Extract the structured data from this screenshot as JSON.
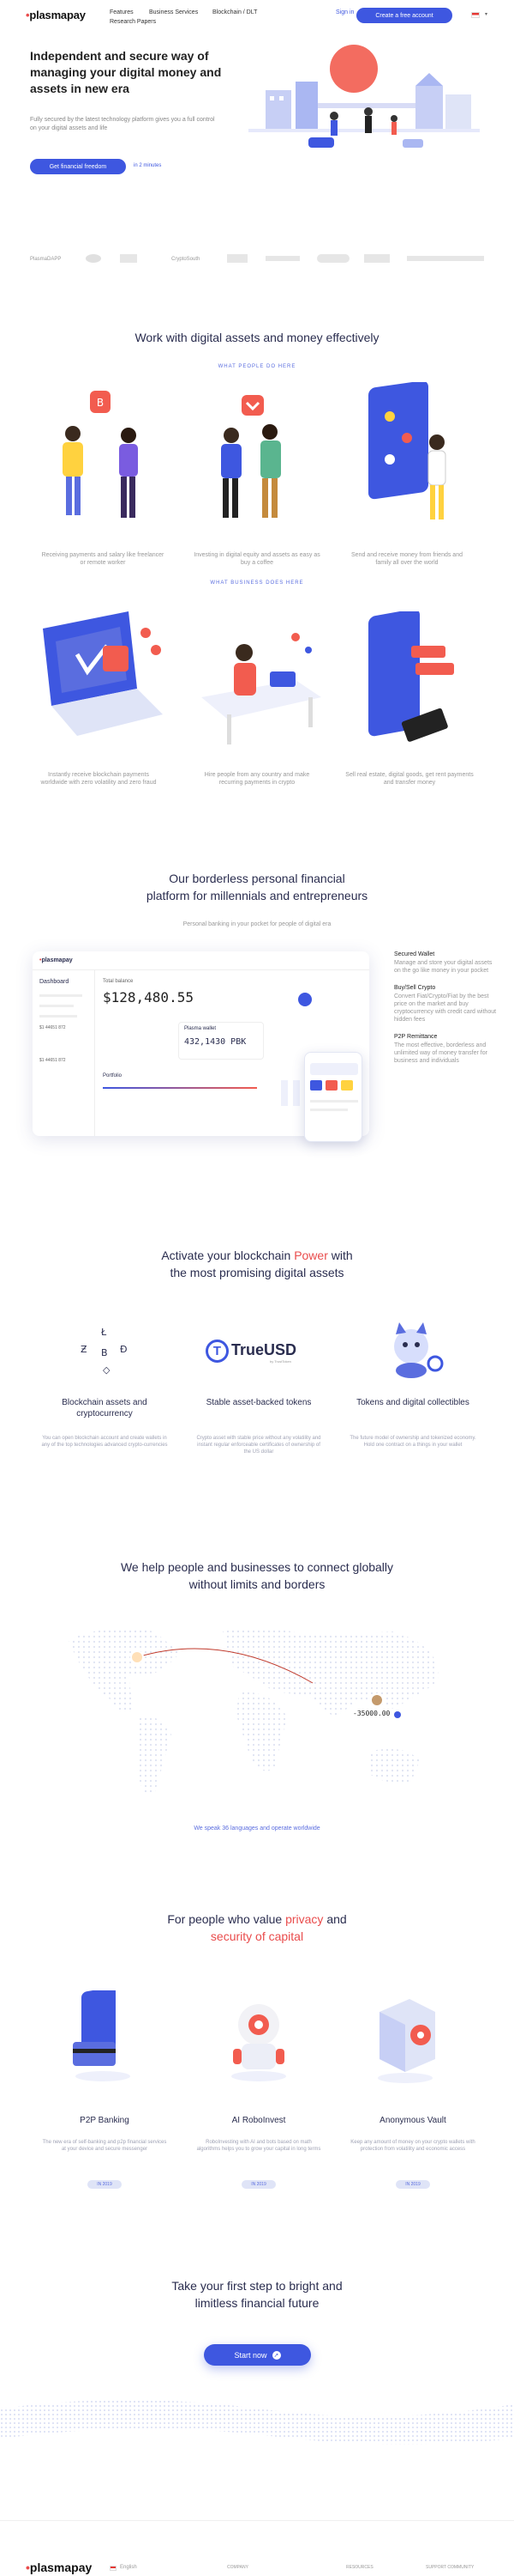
{
  "brand": {
    "name_a": "plasma",
    "name_b": "pay"
  },
  "nav": {
    "features": "Features",
    "business": "Business Services",
    "blockchain": "Blockchain / DLT",
    "research": "Research Papers",
    "signin": "Sign in",
    "cta": "Create a free account"
  },
  "hero": {
    "title": "Independent and secure way of managing your digital money and assets in new era",
    "subtitle": "Fully secured by the latest technology platform gives you a full control on your digital assets and life",
    "button": "Get financial freedom",
    "note": "in 2 minutes"
  },
  "partners": [
    "PlasmaDAPP",
    "",
    "CryptoSouth",
    "",
    ""
  ],
  "effective": {
    "title": "Work with digital assets and money effectively",
    "people_label": "WHAT PEOPLE DO HERE",
    "people": [
      "Receiving payments and salary like freelancer or remote worker",
      "Investing in digital equity and assets as easy as buy a coffee",
      "Send and receive money from friends and family all over the world"
    ],
    "business_label": "WHAT BUSINESS DOES HERE",
    "business": [
      "Instantly receive blockchain payments worldwide with zero volatility and zero fraud",
      "Hire people from any country and make recurring payments in crypto",
      "Sell real estate, digital goods, get rent payments and transfer money"
    ]
  },
  "platform": {
    "title_1": "Our borderless personal financial",
    "title_2": "platform for millennials and entrepreneurs",
    "subtitle": "Personal banking in your pocket for people of digital era",
    "mock": {
      "dashboard": "Dashboard",
      "total": "Total balance",
      "balance": "$128,480.55",
      "wallet": "Plasma wallet",
      "wallet_amount": "432,1430 PBK",
      "portfolio": "Portfolio",
      "card_no": "$1 44651 872",
      "amount2": "$1 44651 872"
    },
    "features": [
      {
        "title": "Secured Wallet",
        "desc": "Manage and store your digital assets on the go like money in your pocket"
      },
      {
        "title": "Buy/Sell Crypto",
        "desc": "Convert Fiat/Crypto/Fiat by the best price on the market and buy cryptocurrency with credit card without hidden fees"
      },
      {
        "title": "P2P Remittance",
        "desc": "The most effective, borderless and unlimited way of money transfer for business and individuals"
      }
    ]
  },
  "activate": {
    "title_a": "Activate your blockchain ",
    "title_b": "Power",
    "title_c": " with",
    "title_2": "the most promising digital assets",
    "cols": [
      {
        "title": "Blockchain assets and cryptocurrency",
        "desc": "You can open blockchain account and create wallets in any of the top technologies advanced crypto-currencies"
      },
      {
        "title": "Stable asset-backed tokens",
        "desc": "Crypto asset with stable price without any volatility and instant regular enforceable certificates of ownership of the US dollar"
      },
      {
        "title": "Tokens and digital collectibles",
        "desc": "The future model of ownership and tokenized economy. Hold one contract on a things in your wallet"
      }
    ],
    "trueusd": "TrueUSD",
    "trueusd_by": "by TrustToken"
  },
  "global": {
    "title_1": "We help people and businesses to connect globally",
    "title_2": "without limits and borders",
    "amount": "-35000.00",
    "note": "We speak 36 languages and operate worldwide"
  },
  "privacy": {
    "title_a": "For people who value ",
    "title_b": "privacy",
    "title_c": " and",
    "title_d": "security of capital",
    "cols": [
      {
        "title": "P2P Banking",
        "desc": "The new era of self-banking and p2p financial services at your device and secure messenger",
        "pill": "IN 2019"
      },
      {
        "title": "AI RoboInvest",
        "desc": "RoboInvesting with AI and bots based on math algorithms helps you to grow your capital in long terms",
        "pill": "IN 2019"
      },
      {
        "title": "Anonymous Vault",
        "desc": "Keep any amount of money on your crypto wallets with protection from volatility and economic access",
        "pill": "IN 2019"
      }
    ]
  },
  "cta": {
    "title_1": "Take your first step to bright and",
    "title_2": "limitless financial future",
    "button": "Start now"
  },
  "footer": {
    "lang": "English",
    "col1": "COMPANY",
    "col2": "RESOURCES",
    "col3": "SUPPORT COMMUNITY"
  },
  "colors": {
    "accent": "#3e57e0",
    "red": "#e94c4c",
    "text": "#2a2d4f"
  }
}
